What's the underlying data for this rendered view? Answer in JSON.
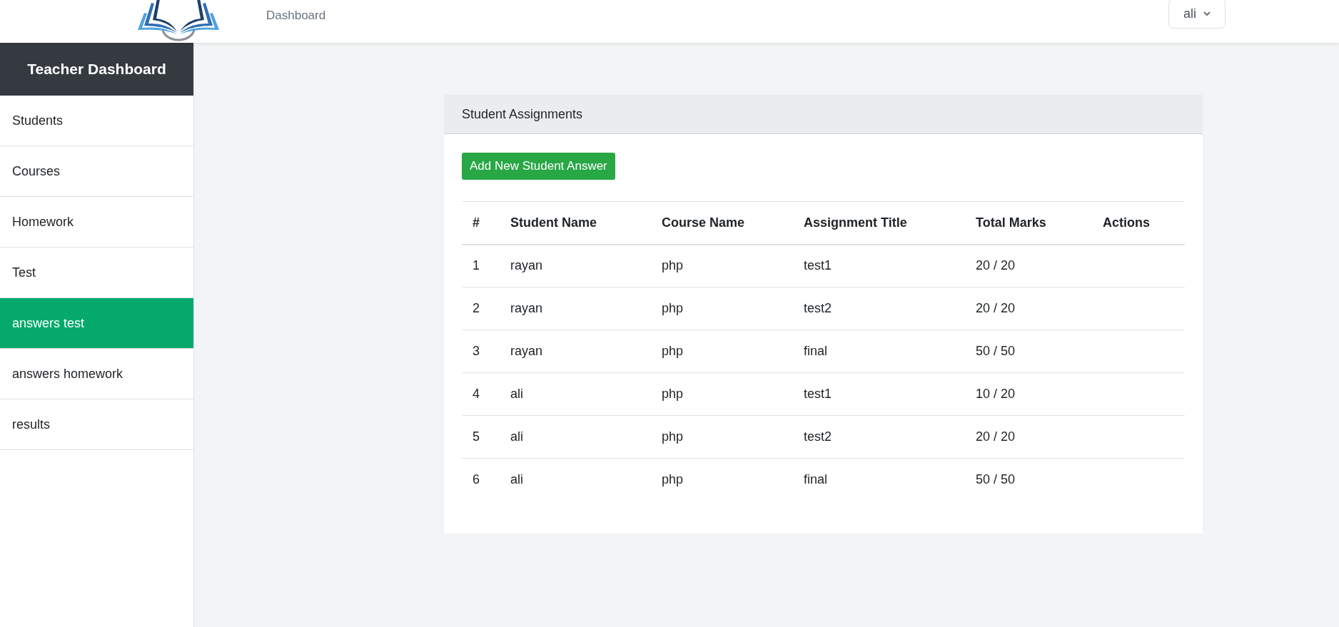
{
  "topbar": {
    "nav_link": "Dashboard",
    "user_menu": "ali"
  },
  "sidebar": {
    "title": "Teacher Dashboard",
    "items": [
      {
        "label": "Students",
        "selected": false
      },
      {
        "label": "Courses",
        "selected": false
      },
      {
        "label": "Homework",
        "selected": false
      },
      {
        "label": "Test",
        "selected": false
      },
      {
        "label": "answers test",
        "selected": true
      },
      {
        "label": "answers homework",
        "selected": false
      },
      {
        "label": "results",
        "selected": false
      }
    ]
  },
  "card": {
    "title": "Student Assignments",
    "add_button": "Add New Student Answer",
    "table": {
      "columns": [
        "#",
        "Student Name",
        "Course Name",
        "Assignment Title",
        "Total Marks",
        "Actions"
      ],
      "rows": [
        [
          "1",
          "rayan",
          "php",
          "test1",
          "20 / 20"
        ],
        [
          "2",
          "rayan",
          "php",
          "test2",
          "20 / 20"
        ],
        [
          "3",
          "rayan",
          "php",
          "final",
          "50 / 50"
        ],
        [
          "4",
          "ali",
          "php",
          "test1",
          "10 / 20"
        ],
        [
          "5",
          "ali",
          "php",
          "test2",
          "20 / 20"
        ],
        [
          "6",
          "ali",
          "php",
          "final",
          "50 / 50"
        ]
      ]
    }
  }
}
